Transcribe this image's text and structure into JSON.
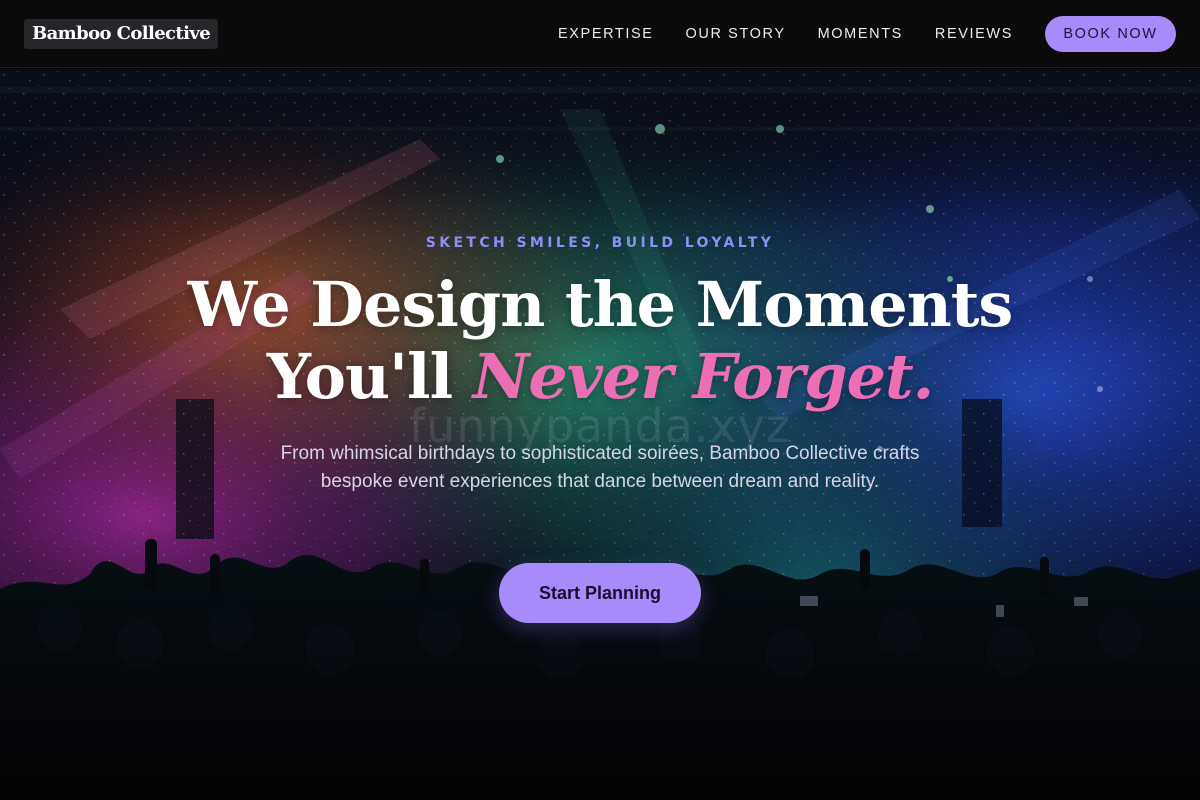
{
  "header": {
    "brand": "Bamboo Collective",
    "nav": [
      {
        "label": "EXPERTISE"
      },
      {
        "label": "OUR STORY"
      },
      {
        "label": "MOMENTS"
      },
      {
        "label": "REVIEWS"
      }
    ],
    "cta_label": "BOOK NOW"
  },
  "hero": {
    "background_image": "concert-crowd-confetti-photo",
    "watermark": "funnypanda.xyz",
    "eyebrow": "SKETCH SMILES, BUILD LOYALTY",
    "headline_line1": "We Design the Moments",
    "headline_line2_plain": "You'll",
    "headline_line2_accent": "Never Forget.",
    "subtitle": "From whimsical birthdays to sophisticated soirées, Bamboo Collective crafts bespoke event experiences that dance between dream and reality.",
    "cta_label": "Start Planning"
  },
  "colors": {
    "accent": "#a78bfa",
    "headline_accent": "#ec6fb3",
    "eyebrow": "#8b8ff6",
    "header_bg": "#0b0b0c"
  }
}
